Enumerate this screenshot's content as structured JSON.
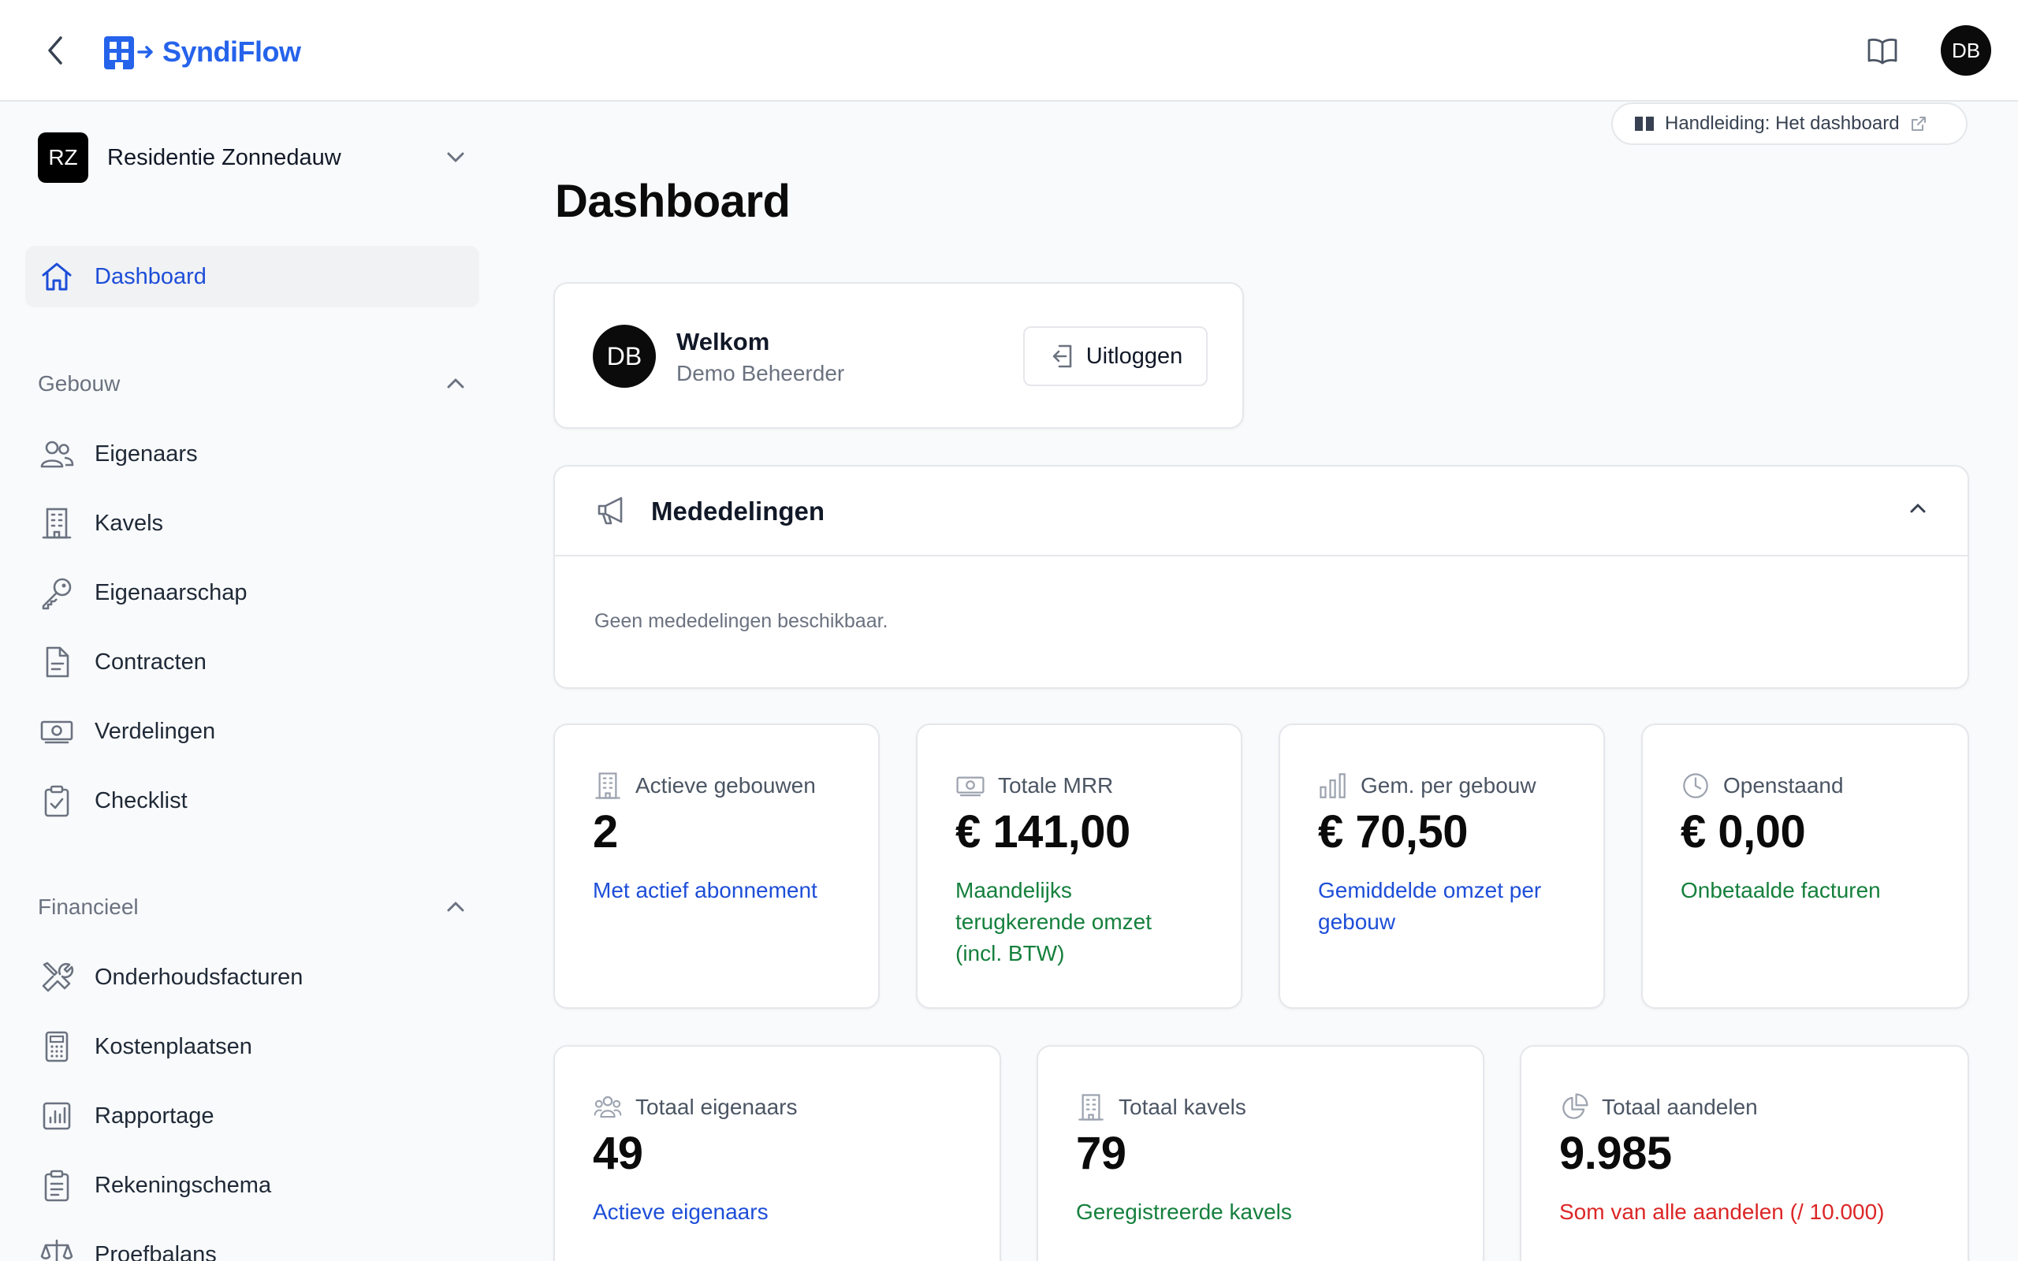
{
  "app": {
    "name": "SyndiFlow",
    "user_initials": "DB"
  },
  "sidebar": {
    "org": {
      "initials": "RZ",
      "name": "Residentie Zonnedauw"
    },
    "dashboard": "Dashboard",
    "sections": {
      "gebouw": {
        "title": "Gebouw",
        "items": [
          "Eigenaars",
          "Kavels",
          "Eigenaarschap",
          "Contracten",
          "Verdelingen",
          "Checklist"
        ]
      },
      "financieel": {
        "title": "Financieel",
        "items": [
          "Onderhoudsfacturen",
          "Kostenplaatsen",
          "Rapportage",
          "Rekeningschema",
          "Proefbalans"
        ]
      }
    }
  },
  "main": {
    "manual_link": "Handleiding: Het dashboard",
    "title": "Dashboard",
    "welcome": {
      "initials": "DB",
      "greeting": "Welkom",
      "name": "Demo Beheerder",
      "logout": "Uitloggen"
    },
    "announcements": {
      "title": "Mededelingen",
      "empty": "Geen mededelingen beschikbaar."
    },
    "stats": [
      {
        "label": "Actieve gebouwen",
        "value": "2",
        "sub": "Met actief abonnement",
        "tone": "blue"
      },
      {
        "label": "Totale MRR",
        "value": "€ 141,00",
        "sub": "Maandelijks terugkerende omzet (incl. BTW)",
        "tone": "green"
      },
      {
        "label": "Gem. per gebouw",
        "value": "€ 70,50",
        "sub": "Gemiddelde omzet per gebouw",
        "tone": "blue"
      },
      {
        "label": "Openstaand",
        "value": "€ 0,00",
        "sub": "Onbetaalde facturen",
        "tone": "green"
      },
      {
        "label": "Totaal eigenaars",
        "value": "49",
        "sub": "Actieve eigenaars",
        "tone": "blue"
      },
      {
        "label": "Totaal kavels",
        "value": "79",
        "sub": "Geregistreerde kavels",
        "tone": "green"
      },
      {
        "label": "Totaal aandelen",
        "value": "9.985",
        "sub": "Som van alle aandelen (/ 10.000)",
        "tone": "red"
      }
    ]
  }
}
